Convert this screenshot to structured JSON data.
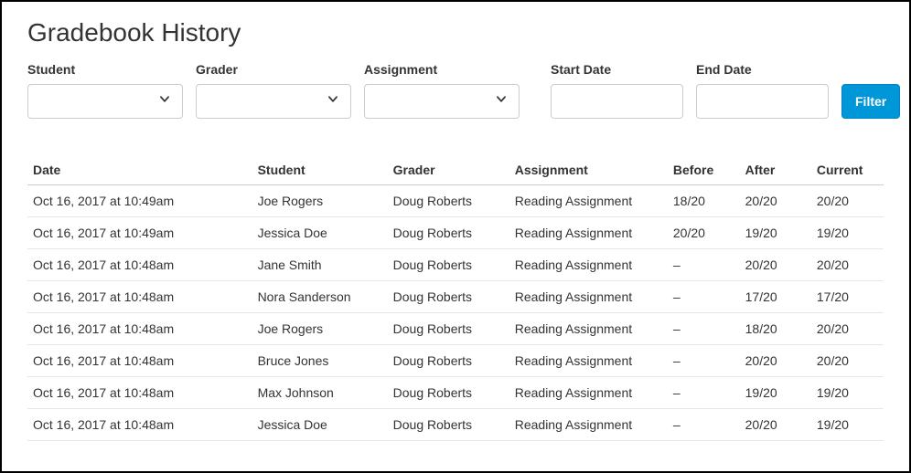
{
  "page": {
    "title": "Gradebook History"
  },
  "filters": {
    "student": {
      "label": "Student"
    },
    "grader": {
      "label": "Grader"
    },
    "assignment": {
      "label": "Assignment"
    },
    "start_date": {
      "label": "Start Date",
      "value": ""
    },
    "end_date": {
      "label": "End Date",
      "value": ""
    },
    "filter_button": "Filter"
  },
  "columns": {
    "date": "Date",
    "student": "Student",
    "grader": "Grader",
    "assignment": "Assignment",
    "before": "Before",
    "after": "After",
    "current": "Current"
  },
  "rows": [
    {
      "date": "Oct 16, 2017 at 10:49am",
      "student": "Joe Rogers",
      "grader": "Doug Roberts",
      "assignment": "Reading Assignment",
      "before": "18/20",
      "after": "20/20",
      "current": "20/20"
    },
    {
      "date": "Oct 16, 2017 at 10:49am",
      "student": "Jessica Doe",
      "grader": "Doug Roberts",
      "assignment": "Reading Assignment",
      "before": "20/20",
      "after": "19/20",
      "current": "19/20"
    },
    {
      "date": "Oct 16, 2017 at 10:48am",
      "student": "Jane Smith",
      "grader": "Doug Roberts",
      "assignment": "Reading Assignment",
      "before": "–",
      "after": "20/20",
      "current": "20/20"
    },
    {
      "date": "Oct 16, 2017 at 10:48am",
      "student": "Nora Sanderson",
      "grader": "Doug Roberts",
      "assignment": "Reading Assignment",
      "before": "–",
      "after": "17/20",
      "current": "17/20"
    },
    {
      "date": "Oct 16, 2017 at 10:48am",
      "student": "Joe Rogers",
      "grader": "Doug Roberts",
      "assignment": "Reading Assignment",
      "before": "–",
      "after": "18/20",
      "current": "20/20"
    },
    {
      "date": "Oct 16, 2017 at 10:48am",
      "student": "Bruce Jones",
      "grader": "Doug Roberts",
      "assignment": "Reading Assignment",
      "before": "–",
      "after": "20/20",
      "current": "20/20"
    },
    {
      "date": "Oct 16, 2017 at 10:48am",
      "student": "Max Johnson",
      "grader": "Doug Roberts",
      "assignment": "Reading Assignment",
      "before": "–",
      "after": "19/20",
      "current": "19/20"
    },
    {
      "date": "Oct 16, 2017 at 10:48am",
      "student": "Jessica Doe",
      "grader": "Doug Roberts",
      "assignment": "Reading Assignment",
      "before": "–",
      "after": "20/20",
      "current": "19/20"
    }
  ]
}
